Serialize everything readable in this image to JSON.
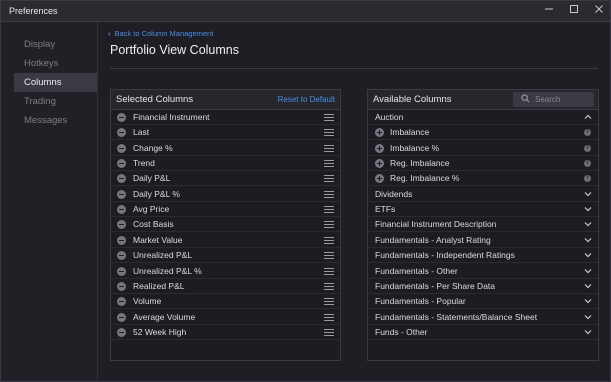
{
  "window": {
    "title": "Preferences"
  },
  "sidebar": {
    "items": [
      {
        "label": "Display",
        "active": false
      },
      {
        "label": "Hotkeys",
        "active": false
      },
      {
        "label": "Columns",
        "active": true
      },
      {
        "label": "Trading",
        "active": false
      },
      {
        "label": "Messages",
        "active": false
      }
    ]
  },
  "main": {
    "back_label": "Back to Column Management",
    "title": "Portfolio View Columns"
  },
  "selected": {
    "title": "Selected Columns",
    "reset_label": "Reset to Default",
    "items": [
      "Financial Instrument",
      "Last",
      "Change %",
      "Trend",
      "Daily P&L",
      "Daily P&L %",
      "Avg Price",
      "Cost Basis",
      "Market Value",
      "Unrealized P&L",
      "Unrealized P&L %",
      "Realized P&L",
      "Volume",
      "Average Volume",
      "52 Week High"
    ]
  },
  "available": {
    "title": "Available Columns",
    "search_placeholder": "Search",
    "groups": [
      {
        "label": "Auction",
        "expanded": true,
        "children": [
          "Imbalance",
          "Imbalance %",
          "Reg. Imbalance",
          "Reg. Imbalance %"
        ]
      },
      {
        "label": "Dividends",
        "expanded": false
      },
      {
        "label": "ETFs",
        "expanded": false
      },
      {
        "label": "Financial Instrument Description",
        "expanded": false
      },
      {
        "label": "Fundamentals - Analyst Rating",
        "expanded": false
      },
      {
        "label": "Fundamentals - Independent Ratings",
        "expanded": false
      },
      {
        "label": "Fundamentals - Other",
        "expanded": false
      },
      {
        "label": "Fundamentals - Per Share Data",
        "expanded": false
      },
      {
        "label": "Fundamentals - Popular",
        "expanded": false
      },
      {
        "label": "Fundamentals - Statements/Balance Sheet",
        "expanded": false
      },
      {
        "label": "Funds - Other",
        "expanded": false
      }
    ]
  },
  "colors": {
    "accent": "#4a8fe6",
    "background": "#1e1e24",
    "panel": "#1c1c22"
  }
}
